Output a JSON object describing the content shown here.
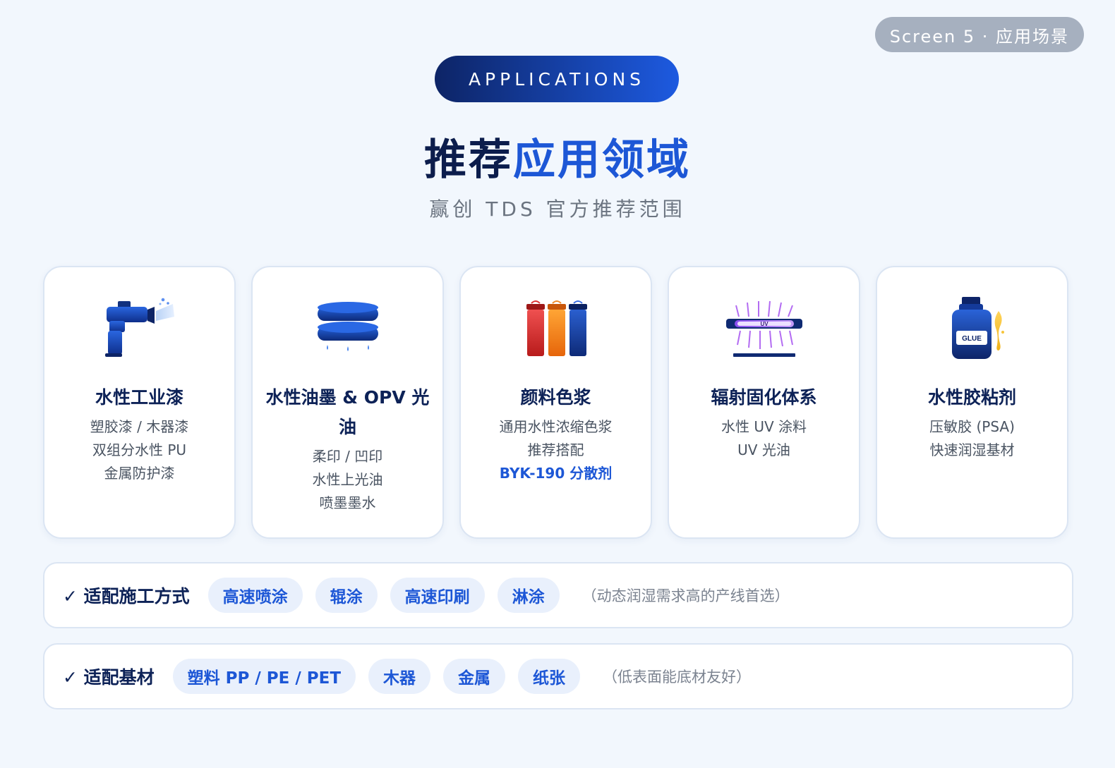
{
  "screen_label": "Screen 5 · 应用场景",
  "header": {
    "eyebrow": "APPLICATIONS",
    "title_part1": "推荐",
    "title_part2": "应用领域",
    "subtitle": "赢创 TDS 官方推荐范围"
  },
  "cards": [
    {
      "icon": "spray-gun-icon",
      "title": "水性工业漆",
      "lines": [
        "塑胶漆 / 木器漆",
        "双组分水性 PU",
        "金属防护漆"
      ],
      "highlight": ""
    },
    {
      "icon": "ink-roller-icon",
      "title": "水性油墨 & OPV 光油",
      "lines": [
        "柔印 / 凹印",
        "水性上光油",
        "喷墨墨水"
      ],
      "highlight": ""
    },
    {
      "icon": "pigment-tubes-icon",
      "title": "颜料色浆",
      "lines": [
        "通用水性浓缩色浆",
        "推荐搭配"
      ],
      "highlight": "BYK-190 分散剂"
    },
    {
      "icon": "uv-lamp-icon",
      "title": "辐射固化体系",
      "lines": [
        "水性 UV 涂料",
        "UV 光油"
      ],
      "highlight": "",
      "icon_text": "UV"
    },
    {
      "icon": "glue-bottle-icon",
      "title": "水性胶粘剂",
      "lines": [
        "压敏胶 (PSA)",
        "快速润湿基材"
      ],
      "highlight": "",
      "icon_text": "GLUE"
    }
  ],
  "fit_methods": {
    "label": "✓ 适配施工方式",
    "chips": [
      "高速喷涂",
      "辊涂",
      "高速印刷",
      "淋涂"
    ],
    "note": "（动态润湿需求高的产线首选）"
  },
  "fit_substrates": {
    "label": "✓ 适配基材",
    "chips": [
      "塑料 PP / PE / PET",
      "木器",
      "金属",
      "纸张"
    ],
    "note": "（低表面能底材友好）"
  },
  "colors": {
    "primary_dark": "#0c1d4c",
    "accent_blue": "#1d57d6",
    "chip_bg": "#e9f0fc",
    "page_bg": "#f2f7fd"
  }
}
